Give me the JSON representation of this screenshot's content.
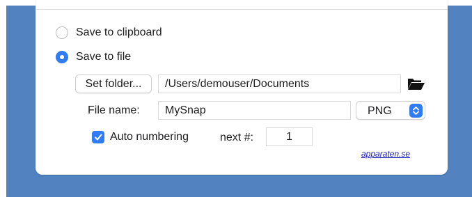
{
  "colors": {
    "backdrop": "#5282c0",
    "accent": "#2f7cf6",
    "link": "#1a1ab8"
  },
  "save_options": {
    "clipboard": {
      "label": "Save to clipboard",
      "selected": false
    },
    "file": {
      "label": "Save to file",
      "selected": true
    }
  },
  "folder": {
    "button_label": "Set folder...",
    "path": "/Users/demouser/Documents",
    "open_icon": "folder-open-icon"
  },
  "file_name": {
    "label": "File name:",
    "value": "MySnap"
  },
  "format": {
    "selected": "PNG",
    "icon": "chevron-up-down-icon"
  },
  "auto_numbering": {
    "label": "Auto numbering",
    "checked": true,
    "next_label": "next #:",
    "next_value": "1"
  },
  "footer": {
    "link_text": "apparaten.se"
  }
}
